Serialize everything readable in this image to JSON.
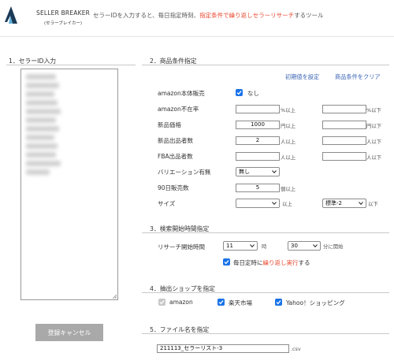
{
  "header": {
    "logo_title": "SELLER BREAKER",
    "logo_sub": "(セラーブレイカー)",
    "desc_pre": "セラーIDを入力すると、毎日指定時刻、",
    "desc_highlight": "指定条件で繰り返しセラーリサーチ",
    "desc_post": "するツール"
  },
  "section1": {
    "title": "1．セラーID入力",
    "cancel_button": "登録キャンセル"
  },
  "section2": {
    "title": "2．商品条件指定",
    "reset_link": "初期値を設定",
    "clear_link": "商品条件をクリア",
    "amazon_sales": {
      "label": "amazon本体販売",
      "checked": true,
      "checkbox_label": "なし"
    },
    "amazon_absent": {
      "label": "amazon不在率",
      "min": "",
      "min_unit": "%以上",
      "max": "",
      "max_unit": "%以下"
    },
    "new_price": {
      "label": "新品価格",
      "min": "1000",
      "min_unit": "円以上",
      "max": "",
      "max_unit": "円以下"
    },
    "new_sellers": {
      "label": "新品出品者数",
      "min": "2",
      "min_unit": "人以上",
      "max": "",
      "max_unit": "人以下"
    },
    "fba_sellers": {
      "label": "FBA出品者数",
      "min": "",
      "min_unit": "人以上",
      "max": "",
      "max_unit": "人以下"
    },
    "variation": {
      "label": "バリエーション有無",
      "value": "無し"
    },
    "sales_90": {
      "label": "90日販売数",
      "min": "5",
      "unit": "個以上"
    },
    "size": {
      "label": "サイズ",
      "min": "",
      "min_unit": "以上",
      "max": "標準-2",
      "max_unit": "以下"
    }
  },
  "section3": {
    "title": "3．検索開始時間指定",
    "start_label": "リサーチ開始時間",
    "hour": "11",
    "hour_unit": "時",
    "minute": "30",
    "minute_unit": "分に開始",
    "daily_pre": "毎日定時に",
    "daily_highlight": "繰り返し実行",
    "daily_post": "する",
    "daily_checked": true
  },
  "section4": {
    "title": "4．抽出ショップを指定",
    "shops": [
      {
        "label": "amazon",
        "checked": true,
        "disabled": true
      },
      {
        "label": "楽天市場",
        "checked": true,
        "disabled": false
      },
      {
        "label": "Yahoo！ショッピング",
        "checked": true,
        "disabled": false
      }
    ]
  },
  "section5": {
    "title": "5．ファイル名を指定",
    "filename": "211113_セラーリスト-3",
    "ext": ".csv"
  },
  "colors": {
    "accent": "#1a73e8",
    "highlight": "#e8452c",
    "link": "#3a66b5",
    "cancel_button": "#a9a9a9"
  },
  "icons": {
    "logo": "seller-breaker-logo",
    "checkbox": "check-icon",
    "select": "chevron-down-icon",
    "resize": "resize-grip-icon"
  }
}
